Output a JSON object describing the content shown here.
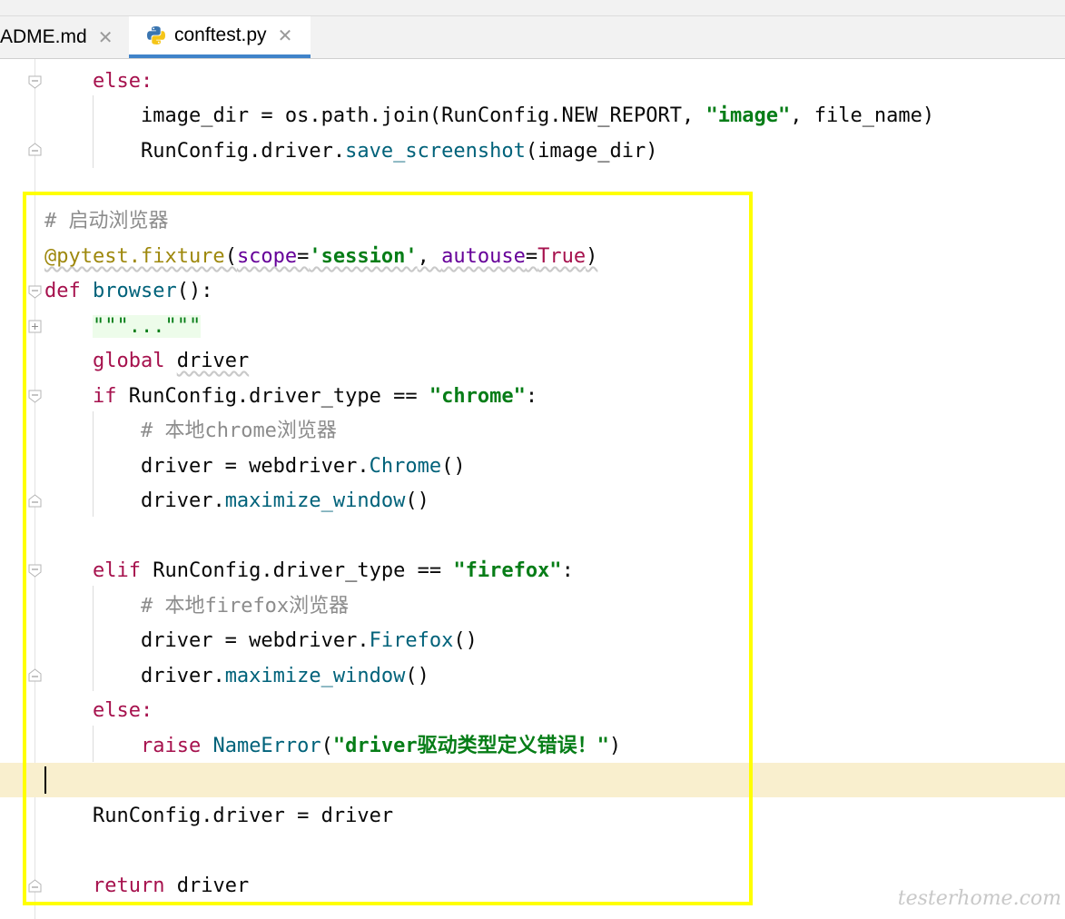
{
  "tabs": [
    {
      "label": "ADME.md",
      "active": false
    },
    {
      "label": "conftest.py",
      "active": true
    }
  ],
  "code": {
    "l1": "else:",
    "l2_a": "image_dir = os.path.join(RunConfig.NEW_REPORT, ",
    "l2_s": "\"image\"",
    "l2_b": ", file_name)",
    "l3_a": "RunConfig.driver.",
    "l3_f": "save_screenshot",
    "l3_b": "(image_dir)",
    "c1": "# 启动浏览器",
    "dec_a": "@pytest.fixture",
    "dec_p1": "scope",
    "dec_s": "'session'",
    "dec_p2": "autouse",
    "dec_v": "True",
    "def_kw": "def",
    "def_fn": "browser",
    "def_rest": "():",
    "docstr": "\"\"\"...\"\"\"",
    "global_kw": "global",
    "global_var": "driver",
    "if_kw": "if",
    "if_rest": " RunConfig.driver_type == ",
    "if_s": "\"chrome\"",
    "c2": "# 本地chrome浏览器",
    "ch_a": "driver = webdriver.",
    "ch_f": "Chrome",
    "ch_b": "()",
    "max_a": "driver.",
    "max_f": "maximize_window",
    "max_b": "()",
    "elif_kw": "elif",
    "elif_s": "\"firefox\"",
    "c3": "# 本地firefox浏览器",
    "ff_f": "Firefox",
    "else_kw": "else:",
    "raise_kw": "raise",
    "raise_cls": "NameError",
    "raise_s": "\"driver驱动类型定义错误！\"",
    "assign": "RunConfig.driver = driver",
    "ret_kw": "return",
    "ret_var": "driver"
  },
  "watermark": "testerhome.com",
  "colors": {
    "highlight": "#ffff00",
    "tab_underline": "#4083c9"
  }
}
